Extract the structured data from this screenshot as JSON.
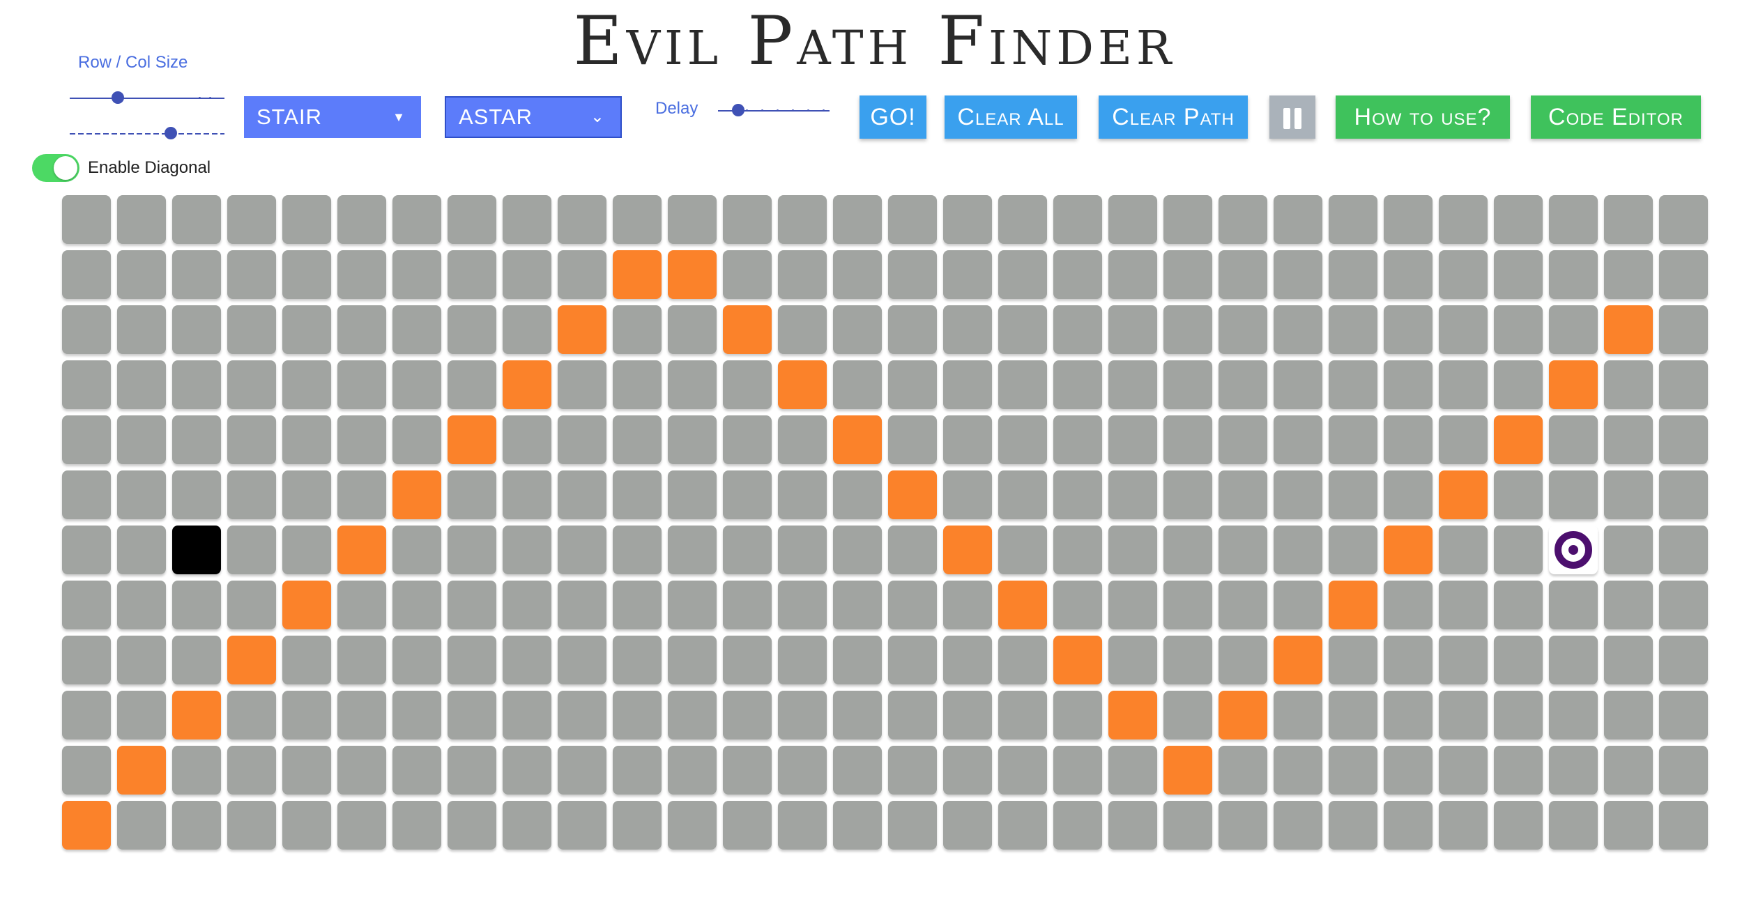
{
  "title": "Evil Path Finder",
  "controls": {
    "size_label": "Row / Col Size",
    "grid_select": "STAIR",
    "algorithm_select": "ASTAR",
    "delay_label": "Delay",
    "go_label": "GO!",
    "clear_all_label": "Clear All",
    "clear_path_label": "Clear Path",
    "how_to_label": "How to use?",
    "code_editor_label": "Code Editor",
    "diagonal_label": "Enable Diagonal",
    "diagonal_enabled": true
  },
  "grid": {
    "rows": 12,
    "cols": 30,
    "start": [
      6,
      2
    ],
    "target": [
      6,
      27
    ],
    "walls": [
      [
        1,
        10
      ],
      [
        1,
        11
      ],
      [
        2,
        9
      ],
      [
        2,
        12
      ],
      [
        2,
        28
      ],
      [
        3,
        8
      ],
      [
        3,
        13
      ],
      [
        3,
        27
      ],
      [
        4,
        7
      ],
      [
        4,
        14
      ],
      [
        4,
        26
      ],
      [
        5,
        6
      ],
      [
        5,
        15
      ],
      [
        5,
        25
      ],
      [
        6,
        5
      ],
      [
        6,
        16
      ],
      [
        6,
        24
      ],
      [
        7,
        4
      ],
      [
        7,
        17
      ],
      [
        7,
        23
      ],
      [
        8,
        3
      ],
      [
        8,
        18
      ],
      [
        8,
        22
      ],
      [
        9,
        2
      ],
      [
        9,
        19
      ],
      [
        9,
        21
      ],
      [
        10,
        1
      ],
      [
        10,
        20
      ],
      [
        11,
        0
      ]
    ]
  },
  "colors": {
    "cell": "#a1a4a1",
    "wall": "#fb822a",
    "start": "#000000",
    "target": "#4c0f6e",
    "accent": "#3f51b5"
  }
}
